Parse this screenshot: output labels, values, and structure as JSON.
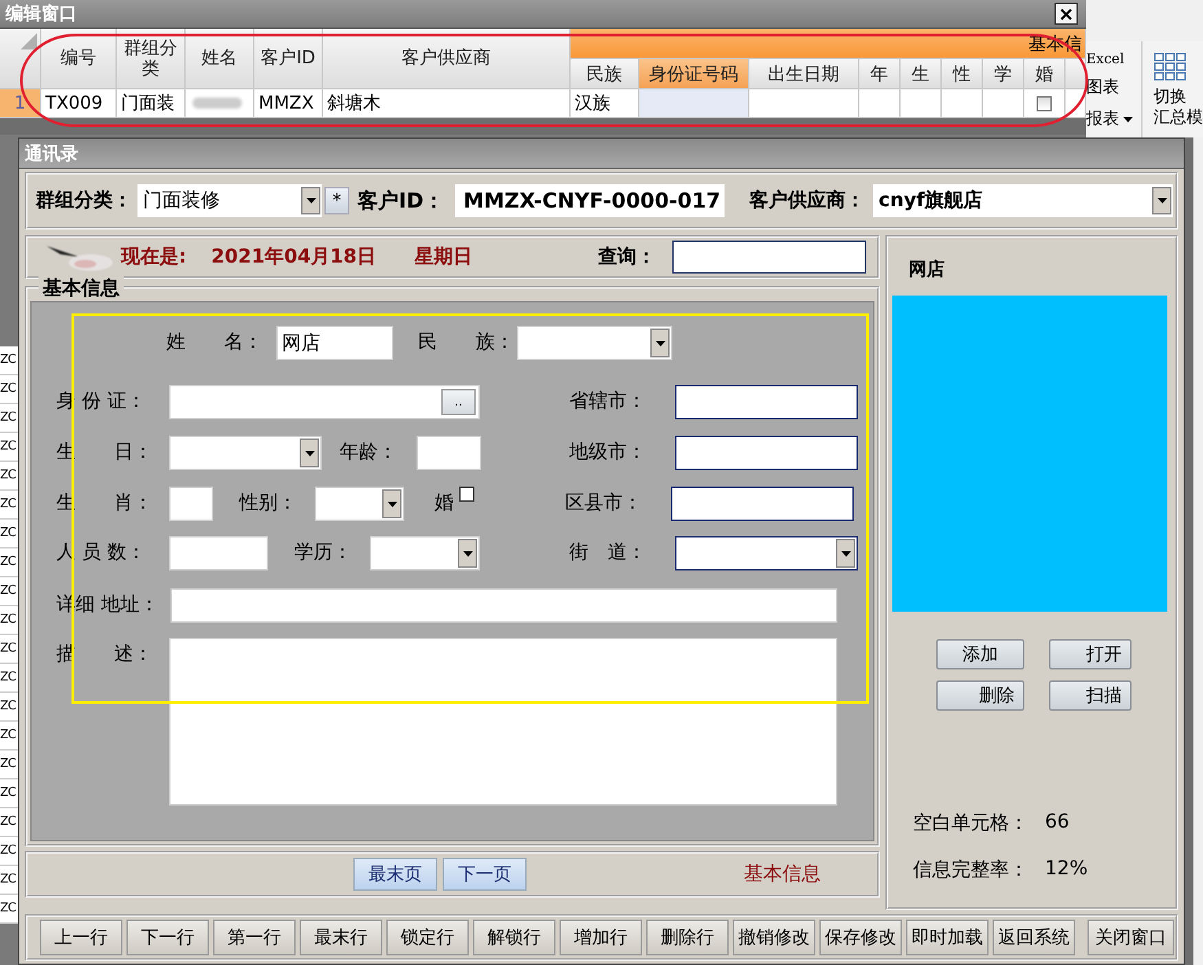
{
  "editor_window": {
    "title": "编辑窗口",
    "grid": {
      "group_header": "基本信",
      "columns": [
        {
          "label": "编号",
          "selected": false
        },
        {
          "label": "群组分类",
          "selected": false
        },
        {
          "label": "姓名",
          "selected": false
        },
        {
          "label": "客户ID",
          "selected": false
        },
        {
          "label": "客户供应商",
          "selected": false
        }
      ],
      "group_columns": [
        {
          "label": "民族",
          "selected": false
        },
        {
          "label": "身份证号码",
          "selected": true
        },
        {
          "label": "出生日期",
          "selected": false
        },
        {
          "label": "年",
          "selected": false
        },
        {
          "label": "生",
          "selected": false
        },
        {
          "label": "性",
          "selected": false
        },
        {
          "label": "学",
          "selected": false
        },
        {
          "label": "婚",
          "selected": false
        }
      ],
      "rows": [
        {
          "row_number": "1",
          "selected": true,
          "cells": [
            {
              "kind": "text",
              "text": "TX009"
            },
            {
              "kind": "text",
              "text": "门面装"
            },
            {
              "kind": "redacted"
            },
            {
              "kind": "text",
              "text": "MMZX"
            },
            {
              "kind": "text",
              "text": "斜塘木"
            },
            {
              "kind": "text",
              "text": "汉族"
            },
            {
              "kind": "text",
              "text": "",
              "selected": true
            },
            {
              "kind": "text"
            },
            {
              "kind": "text"
            },
            {
              "kind": "text"
            },
            {
              "kind": "text"
            },
            {
              "kind": "text"
            },
            {
              "kind": "checkbox",
              "checked": false
            }
          ]
        }
      ]
    },
    "side_cells": [
      "ZC",
      "ZC",
      "ZC",
      "ZC",
      "ZC",
      "ZC",
      "ZC",
      "ZC",
      "ZC",
      "ZC",
      "ZC",
      "ZC",
      "ZC",
      "ZC",
      "ZC",
      "ZC",
      "ZC",
      "ZC",
      "ZC",
      "ZC"
    ]
  },
  "ribbon": {
    "small_items": [
      "Excel",
      "图表",
      "报表"
    ],
    "big_item": [
      "切换",
      "汇总模"
    ]
  },
  "contacts_window": {
    "title": "通讯录",
    "header": {
      "group_label": "群组分类：",
      "group_value": "门面装修",
      "star_button": "*",
      "id_label": "客户ID：",
      "id_value": "MMZX-CNYF-0000-017",
      "supplier_label": "客户供应商：",
      "supplier_value": "cnyf旗舰店"
    },
    "date_bar": {
      "prefix": "现在是:",
      "date": "2021年04月18日",
      "weekday": "星期日",
      "search_label": "查询："
    },
    "basic_info": {
      "title": "基本信息",
      "fields": [
        {
          "kind": "text",
          "label": "姓　　名：",
          "value": "网店",
          "highlighted": false
        },
        {
          "kind": "dropdown",
          "label": "民　　族：",
          "highlighted": false
        },
        {
          "kind": "lookup",
          "label": "身 份 证：",
          "button": "..",
          "highlighted": false
        },
        {
          "kind": "text",
          "label": "省辖市：",
          "highlighted": true
        },
        {
          "kind": "dropdown",
          "label": "生　　日：",
          "highlighted": false
        },
        {
          "kind": "text",
          "label": "年龄：",
          "highlighted": false
        },
        {
          "kind": "text",
          "label": "地级市：",
          "highlighted": true
        },
        {
          "kind": "text",
          "label": "生　　肖：",
          "highlighted": false
        },
        {
          "kind": "dropdown",
          "label": "性别：",
          "highlighted": false
        },
        {
          "kind": "checkbox",
          "label": "婚",
          "checked": false
        },
        {
          "kind": "text",
          "label": "区县市：",
          "highlighted": true
        },
        {
          "kind": "text",
          "label": "人 员 数：",
          "highlighted": false
        },
        {
          "kind": "dropdown",
          "label": "学历：",
          "highlighted": false
        },
        {
          "kind": "dropdown",
          "label": "街　道：",
          "highlighted": true
        },
        {
          "kind": "text",
          "label": "详细 地址：",
          "highlighted": false
        },
        {
          "kind": "textarea",
          "label": "描　　述：",
          "highlighted": false
        }
      ]
    },
    "nav": {
      "buttons": [
        "最末页",
        "下一页"
      ],
      "section": "基本信息"
    },
    "side_panel": {
      "title": "网店",
      "buttons": [
        "添加",
        "打开",
        "删除",
        "扫描"
      ],
      "stats": [
        {
          "label": "空白单元格：",
          "value": "66"
        },
        {
          "label": "信息完整率：",
          "value": "12%"
        }
      ]
    },
    "toolbar": [
      "上一行",
      "下一行",
      "第一行",
      "最末行",
      "锁定行",
      "解锁行",
      "增加行",
      "删除行",
      "撤销修改",
      "保存修改",
      "即时加载",
      "返回系统",
      "关闭窗口"
    ]
  },
  "annotations": [
    {
      "kind": "ellipse",
      "color": "#e02030"
    },
    {
      "kind": "rectangle",
      "color": "#ffee00"
    }
  ]
}
